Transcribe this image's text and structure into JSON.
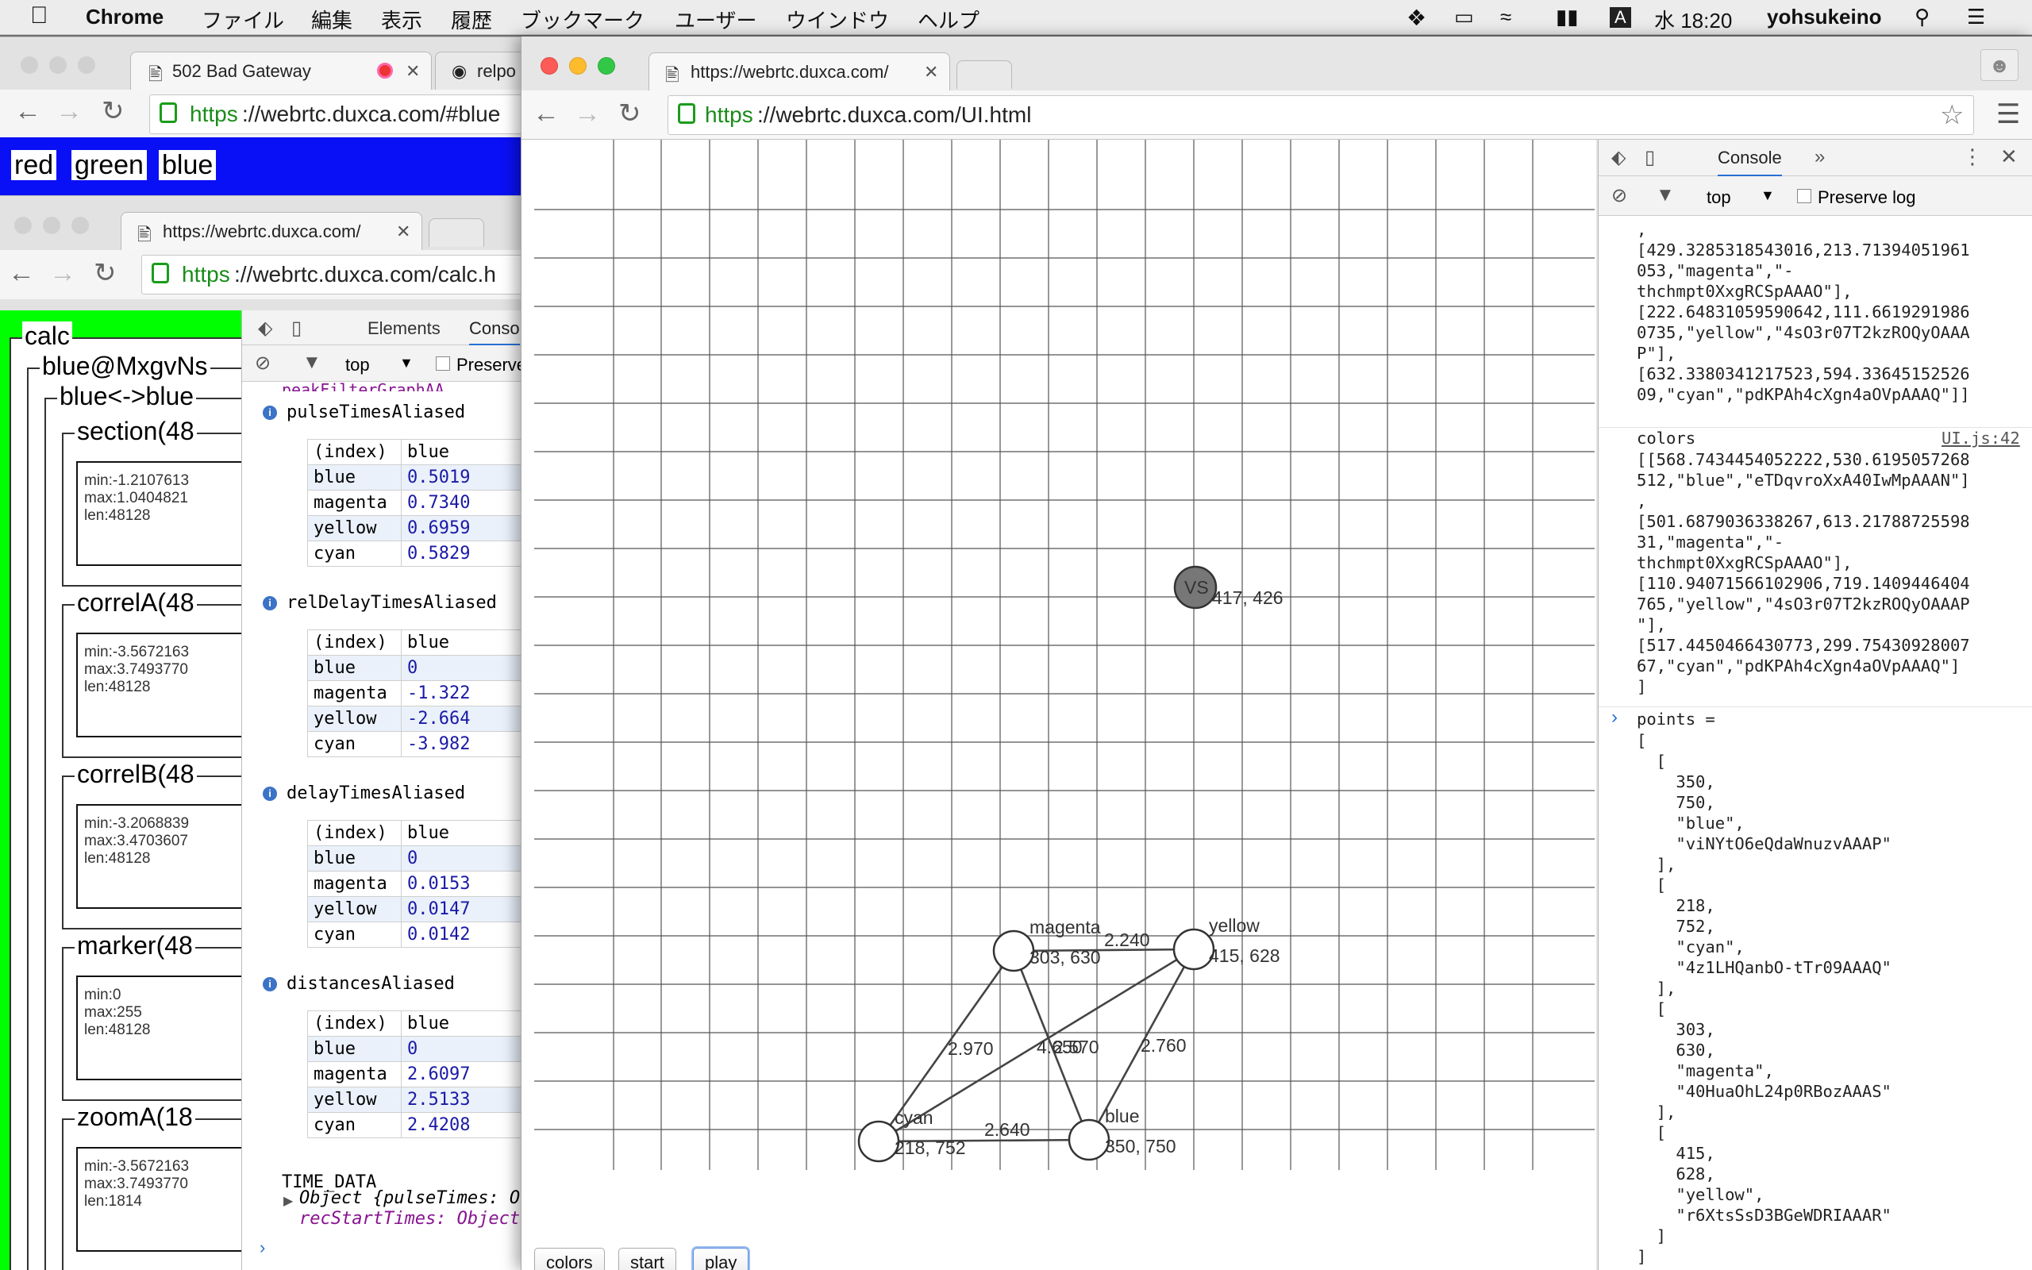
{
  "menubar": {
    "app": "Chrome",
    "items": [
      "ファイル",
      "編集",
      "表示",
      "履歴",
      "ブックマーク",
      "ユーザー",
      "ウインドウ",
      "ヘルプ"
    ],
    "input_source": "A",
    "clock": "水 18:20",
    "user": "yohsukeino"
  },
  "win_back": {
    "tabs": [
      {
        "title": "502 Bad Gateway"
      },
      {
        "title": "relpo"
      }
    ],
    "url_scheme": "https",
    "url_rest": "://webrtc.duxca.com/#blue",
    "buttons": [
      "red",
      "green",
      "blue"
    ],
    "bar_color": "#0a10f5"
  },
  "win_mid": {
    "tab_title": "https://webrtc.duxca.com/",
    "url_scheme": "https",
    "url_rest": "://webrtc.duxca.com/calc.h",
    "tree": {
      "root": "calc",
      "peer": "blue@MxgvNs",
      "pair": "blue<->blue",
      "sections": [
        {
          "label": "section(48",
          "stats": [
            "min:-1.2107613",
            "max:1.0404821",
            "len:48128"
          ]
        },
        {
          "label": "correlA(48",
          "stats": [
            "min:-3.5672163",
            "max:3.7493770",
            "len:48128"
          ]
        },
        {
          "label": "correlB(48",
          "stats": [
            "min:-3.2068839",
            "max:3.4703607",
            "len:48128"
          ]
        },
        {
          "label": "marker(48",
          "stats": [
            "min:0",
            "max:255",
            "len:48128"
          ]
        },
        {
          "label": "zoomA(18",
          "stats": [
            "min:-3.5672163",
            "max:3.7493770",
            "len:1814"
          ]
        }
      ]
    },
    "devtools": {
      "tabs": [
        "Elements",
        "Conso"
      ],
      "context": "top",
      "preserve_log": "Preserve",
      "truncated_top": "peakFilterGraphAA",
      "groups": [
        {
          "name": "pulseTimesAliased",
          "header": [
            "(index)",
            "blue"
          ],
          "rows": [
            [
              "blue",
              "0.5019"
            ],
            [
              "magenta",
              "0.7340"
            ],
            [
              "yellow",
              "0.6959"
            ],
            [
              "cyan",
              "0.5829"
            ]
          ]
        },
        {
          "name": "relDelayTimesAliased",
          "header": [
            "(index)",
            "blue"
          ],
          "rows": [
            [
              "blue",
              "0"
            ],
            [
              "magenta",
              "-1.322"
            ],
            [
              "yellow",
              "-2.664"
            ],
            [
              "cyan",
              "-3.982"
            ]
          ]
        },
        {
          "name": "delayTimesAliased",
          "header": [
            "(index)",
            "blue"
          ],
          "rows": [
            [
              "blue",
              "0"
            ],
            [
              "magenta",
              "0.0153"
            ],
            [
              "yellow",
              "0.0147"
            ],
            [
              "cyan",
              "0.0142"
            ]
          ]
        },
        {
          "name": "distancesAliased",
          "header": [
            "(index)",
            "blue"
          ],
          "rows": [
            [
              "blue",
              "0"
            ],
            [
              "magenta",
              "2.6097"
            ],
            [
              "yellow",
              "2.5133"
            ],
            [
              "cyan",
              "2.4208"
            ]
          ]
        }
      ],
      "time_data": "TIME_DATA",
      "object_line": "Object {pulseTimes: O",
      "object_line2": "recStartTimes: Object"
    }
  },
  "win_front": {
    "tab_title": "https://webrtc.duxca.com/",
    "url_scheme": "https",
    "url_rest": "://webrtc.duxca.com/UI.html",
    "canvas": {
      "vs": {
        "label": "VS",
        "coord": "417, 426"
      },
      "nodes": [
        {
          "name": "magenta",
          "coord": "303, 630"
        },
        {
          "name": "yellow",
          "coord": "415, 628"
        },
        {
          "name": "cyan",
          "coord": "218, 752"
        },
        {
          "name": "blue",
          "coord": "350, 750"
        }
      ],
      "edge_labels": [
        "2.240",
        "2.970",
        "4.650",
        "2.570",
        "2.760",
        "2.640"
      ]
    },
    "buttons": [
      "colors",
      "start",
      "play"
    ],
    "devtools": {
      "tab": "Console",
      "context": "top",
      "preserve_log": "Preserve log",
      "log_top": ",\n[429.3285318543016,213.71394051961\n053,\"magenta\",\"-\nthchmpt0XxgRCSpAAAO\"],\n[222.64831059590642,111.6619291986\n0735,\"yellow\",\"4sO3r07T2kzROQyOAAA\nP\"],\n[632.3380341217523,594.33645152526\n09,\"cyan\",\"pdKPAh4cXgn4aOVpAAAQ\"]]",
      "colors_label": "colors",
      "colors_source": "UI.js:42",
      "colors_body": "[[568.7434454052222,530.6195057268\n512,\"blue\",\"eTDqvroXxA40IwMpAAAN\"]\n,\n[501.6879036338267,613.21788725598\n31,\"magenta\",\"-\nthchmpt0XxgRCSpAAAO\"],\n[110.94071566102906,719.1409446404\n765,\"yellow\",\"4sO3r07T2kzROQyOAAAP\n\"],\n[517.4450466430773,299.75430928007\n67,\"cyan\",\"pdKPAh4cXgn4aOVpAAAQ\"]\n]",
      "input_cmd": "points =",
      "points_body": "[\n  [\n    350,\n    750,\n    \"blue\",\n    \"viNYtO6eQdaWnuzvAAAP\"\n  ],\n  [\n    218,\n    752,\n    \"cyan\",\n    \"4z1LHQanbO-tTr09AAAQ\"\n  ],\n  [\n    303,\n    630,\n    \"magenta\",\n    \"40HuaOhL24p0RBozAAAS\"\n  ],\n  [\n    415,\n    628,\n    \"yellow\",\n    \"r6XtsSsD3BGeWDRIAAAR\"\n  ]\n]"
    }
  }
}
